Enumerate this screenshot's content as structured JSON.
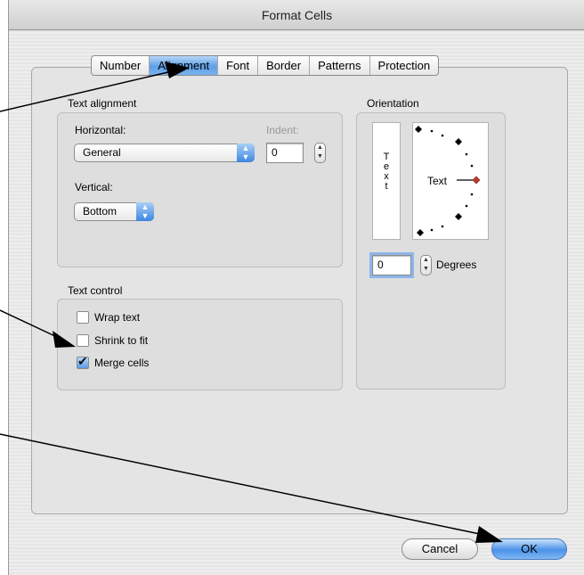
{
  "window": {
    "title": "Format Cells"
  },
  "tabs": [
    {
      "label": "Number",
      "active": false
    },
    {
      "label": "Alignment",
      "active": true
    },
    {
      "label": "Font",
      "active": false
    },
    {
      "label": "Border",
      "active": false
    },
    {
      "label": "Patterns",
      "active": false
    },
    {
      "label": "Protection",
      "active": false
    }
  ],
  "text_alignment": {
    "heading": "Text alignment",
    "horizontal_label": "Horizontal:",
    "horizontal_value": "General",
    "indent_label": "Indent:",
    "indent_value": "0",
    "vertical_label": "Vertical:",
    "vertical_value": "Bottom"
  },
  "text_control": {
    "heading": "Text control",
    "options": [
      {
        "label": "Wrap text",
        "checked": false
      },
      {
        "label": "Shrink to fit",
        "checked": false
      },
      {
        "label": "Merge cells",
        "checked": true
      }
    ]
  },
  "orientation": {
    "heading": "Orientation",
    "vertical_text": [
      "T",
      "e",
      "x",
      "t"
    ],
    "dial_text": "Text",
    "degrees_value": "0",
    "degrees_label": "Degrees"
  },
  "buttons": {
    "cancel": "Cancel",
    "ok": "OK"
  },
  "colors": {
    "accent": "#4b92ea",
    "dial_handle": "#c0392b",
    "annotation_arrow": "#000000"
  }
}
